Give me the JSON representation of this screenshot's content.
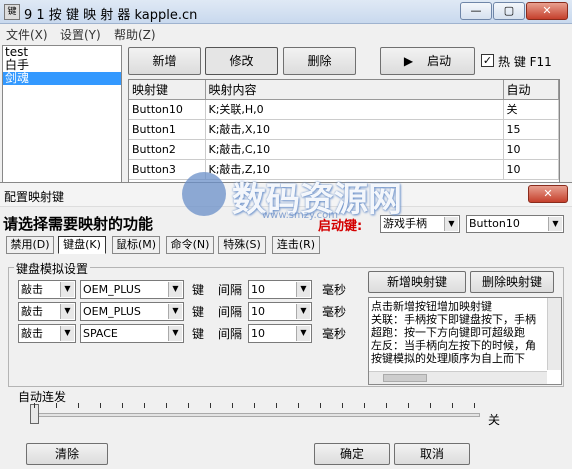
{
  "window": {
    "icon_text": "键",
    "title": "9  1  按  键  映  射  器   kapple.cn",
    "min": "—",
    "max": "▢",
    "close": "✕"
  },
  "menu": [
    "文件(X)",
    "设置(Y)",
    "帮助(Z)"
  ],
  "profiles": [
    "test",
    "白手",
    "剑魂"
  ],
  "selected_profile": "剑魂",
  "toolbar": {
    "add": "新增",
    "edit": "修改",
    "delete": "删除",
    "start": "启动",
    "start_icon": "▶",
    "hotkey_check": "✓",
    "hotkey": "热 键 F11"
  },
  "grid": {
    "headers": [
      "映射键",
      "映射内容",
      "自动"
    ],
    "rows": [
      [
        "Button10",
        "K;关联,H,0",
        "关"
      ],
      [
        "Button1",
        "K;敲击,X,10",
        "15"
      ],
      [
        "Button2",
        "K;敲击,C,10",
        "10"
      ],
      [
        "Button3",
        "K;敲击,Z,10",
        "10"
      ]
    ]
  },
  "dialog": {
    "title": "配置映射键",
    "close": "✕",
    "prompt": "请选择需要映射的功能",
    "start_label": "启动键:",
    "device": "游戏手柄",
    "button": "Button10",
    "tabs": [
      "禁用(D)",
      "键盘(K)",
      "鼠标(M)",
      "命令(N)",
      "特殊(S)",
      "连击(R)"
    ],
    "active_tab": "键盘(K)",
    "group_title": "键盘模拟设置",
    "rows": [
      {
        "action": "敲击",
        "key": "OEM_PLUS",
        "key_label": "键",
        "interval_label": "间隔",
        "interval": "10",
        "unit": "毫秒"
      },
      {
        "action": "敲击",
        "key": "OEM_PLUS",
        "key_label": "键",
        "interval_label": "间隔",
        "interval": "10",
        "unit": "毫秒"
      },
      {
        "action": "敲击",
        "key": "SPACE",
        "key_label": "键",
        "interval_label": "间隔",
        "interval": "10",
        "unit": "毫秒"
      }
    ],
    "add_mapping": "新增映射键",
    "delete_mapping": "删除映射键",
    "help_lines": [
      "点击新增按钮增加映射键",
      "关联：手柄按下即键盘按下，手柄",
      "超跑：按一下方向键即可超级跑",
      "左反：当手柄向左按下的时候，角",
      "按键模拟的处理顺序为自上而下"
    ],
    "auto_fire_label": "自动连发",
    "auto_fire_value": 0,
    "auto_fire_state": "关",
    "clear": "清除",
    "ok": "确定",
    "cancel": "取消"
  },
  "watermark": {
    "logo_text": "数码资源网",
    "url": "www.smzy.com"
  },
  "colors": {
    "selection": "#3399ff",
    "start_key_red": "#d40000",
    "watermark_blue": "#6a8fc8"
  }
}
